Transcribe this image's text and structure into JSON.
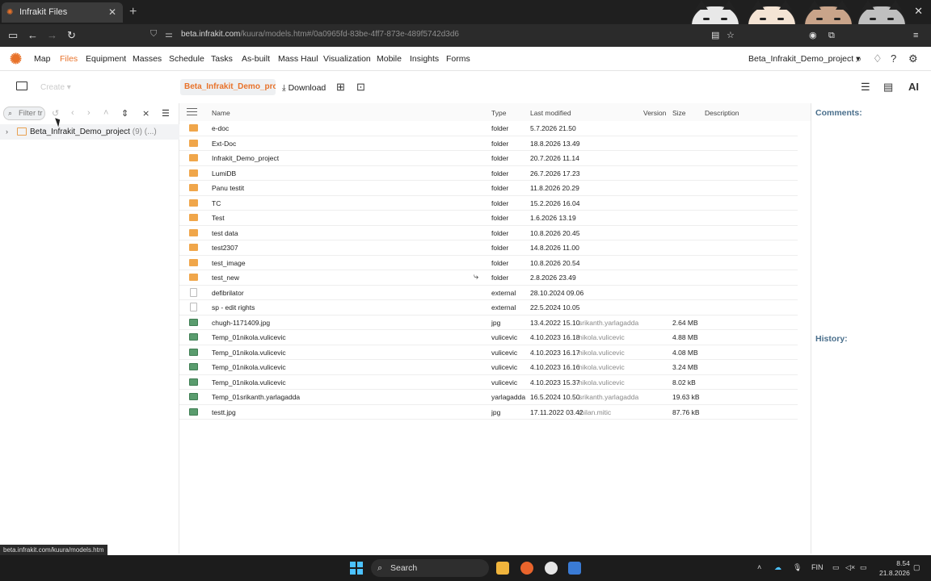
{
  "browser": {
    "tab_title": "Infrakit Files",
    "tab_close": "✕",
    "new_tab": "+",
    "window_close": "✕",
    "url_host": "beta.infrakit.com",
    "url_path": "/kuura/models.htm#/0a0965fd-83be-4ff7-873e-489f5742d3d6"
  },
  "appnav": {
    "items": [
      "Map",
      "Files",
      "Equipment",
      "Masses",
      "Schedule",
      "Tasks",
      "As-built",
      "Mass Haul",
      "Visualization",
      "Mobile",
      "Insights",
      "Forms"
    ],
    "active": "Files",
    "project": "Beta_Infrakit_Demo_project ▾"
  },
  "toolbar": {
    "create_label": "Create ▾",
    "breadcrumb": "Beta_Infrakit_Demo_pro...",
    "download_label": "Download",
    "ai_label": "AI"
  },
  "left_panel": {
    "filter_placeholder": "Filter tr",
    "tree": {
      "label": "Beta_Infrakit_Demo_project",
      "count": "(9) (...)"
    }
  },
  "table": {
    "columns": {
      "name": "Name",
      "type": "Type",
      "modified": "Last modified",
      "version": "Version",
      "size": "Size",
      "description": "Description"
    },
    "rows": [
      {
        "icon": "folder",
        "name": "e-doc",
        "type": "folder",
        "modified": "5.7.2026 21.50",
        "user": "",
        "size": ""
      },
      {
        "icon": "folder",
        "name": "Ext-Doc",
        "type": "folder",
        "modified": "18.8.2026 13.49",
        "user": "",
        "size": ""
      },
      {
        "icon": "folder",
        "name": "Infrakit_Demo_project",
        "type": "folder",
        "modified": "20.7.2026 11.14",
        "user": "",
        "size": ""
      },
      {
        "icon": "folder",
        "name": "LumiDB",
        "type": "folder",
        "modified": "26.7.2026 17.23",
        "user": "",
        "size": ""
      },
      {
        "icon": "folder",
        "name": "Panu testit",
        "type": "folder",
        "modified": "11.8.2026 20.29",
        "user": "",
        "size": ""
      },
      {
        "icon": "folder",
        "name": "TC",
        "type": "folder",
        "modified": "15.2.2026 16.04",
        "user": "",
        "size": ""
      },
      {
        "icon": "folder",
        "name": "Test",
        "type": "folder",
        "modified": "1.6.2026 13.19",
        "user": "",
        "size": ""
      },
      {
        "icon": "folder",
        "name": "test data",
        "type": "folder",
        "modified": "10.8.2026 20.45",
        "user": "",
        "size": ""
      },
      {
        "icon": "folder",
        "name": "test2307",
        "type": "folder",
        "modified": "14.8.2026 11.00",
        "user": "",
        "size": ""
      },
      {
        "icon": "folder",
        "name": "test_image",
        "type": "folder",
        "modified": "10.8.2026 20.54",
        "user": "",
        "size": ""
      },
      {
        "icon": "folder",
        "name": "test_new",
        "type": "folder",
        "modified": "2.8.2026 23.49",
        "user": "",
        "size": ""
      },
      {
        "icon": "external",
        "name": "defibrilator",
        "type": "external",
        "modified": "28.10.2024 09.06",
        "user": "",
        "size": ""
      },
      {
        "icon": "external",
        "name": "sp - edit rights",
        "type": "external",
        "modified": "22.5.2024 10.05",
        "user": "",
        "size": ""
      },
      {
        "icon": "image",
        "name": "chugh-1171409.jpg",
        "type": "jpg",
        "modified": "13.4.2022 15.10",
        "user": "srikanth.yarlagadda",
        "size": "2.64 MB"
      },
      {
        "icon": "image",
        "name": "Temp_01nikola.vulicevic",
        "type": "vulicevic",
        "modified": "4.10.2023 16.18",
        "user": "nikola.vulicevic",
        "size": "4.88 MB"
      },
      {
        "icon": "image",
        "name": "Temp_01nikola.vulicevic",
        "type": "vulicevic",
        "modified": "4.10.2023 16.17",
        "user": "nikola.vulicevic",
        "size": "4.08 MB"
      },
      {
        "icon": "image",
        "name": "Temp_01nikola.vulicevic",
        "type": "vulicevic",
        "modified": "4.10.2023 16.16",
        "user": "nikola.vulicevic",
        "size": "3.24 MB"
      },
      {
        "icon": "image",
        "name": "Temp_01nikola.vulicevic",
        "type": "vulicevic",
        "modified": "4.10.2023 15.37",
        "user": "nikola.vulicevic",
        "size": "8.02 kB"
      },
      {
        "icon": "image",
        "name": "Temp_01srikanth.yarlagadda",
        "type": "yarlagadda",
        "modified": "16.5.2024 10.50",
        "user": "srikanth.yarlagadda",
        "size": "19.63 kB"
      },
      {
        "icon": "image",
        "name": "testt.jpg",
        "type": "jpg",
        "modified": "17.11.2022 03.42",
        "user": "milan.mitic",
        "size": "87.76 kB"
      }
    ]
  },
  "right_panel": {
    "comments": "Comments:",
    "history": "History:"
  },
  "status_url": "beta.infrakit.com/kuura/models.htm",
  "taskbar": {
    "search_label": "Search",
    "language": "FIN",
    "time": "8.54",
    "date": "21.8.2026"
  },
  "colors": {
    "accent": "#e8722a",
    "folder": "#f0a64a",
    "panel_title": "#4a6f8c"
  }
}
